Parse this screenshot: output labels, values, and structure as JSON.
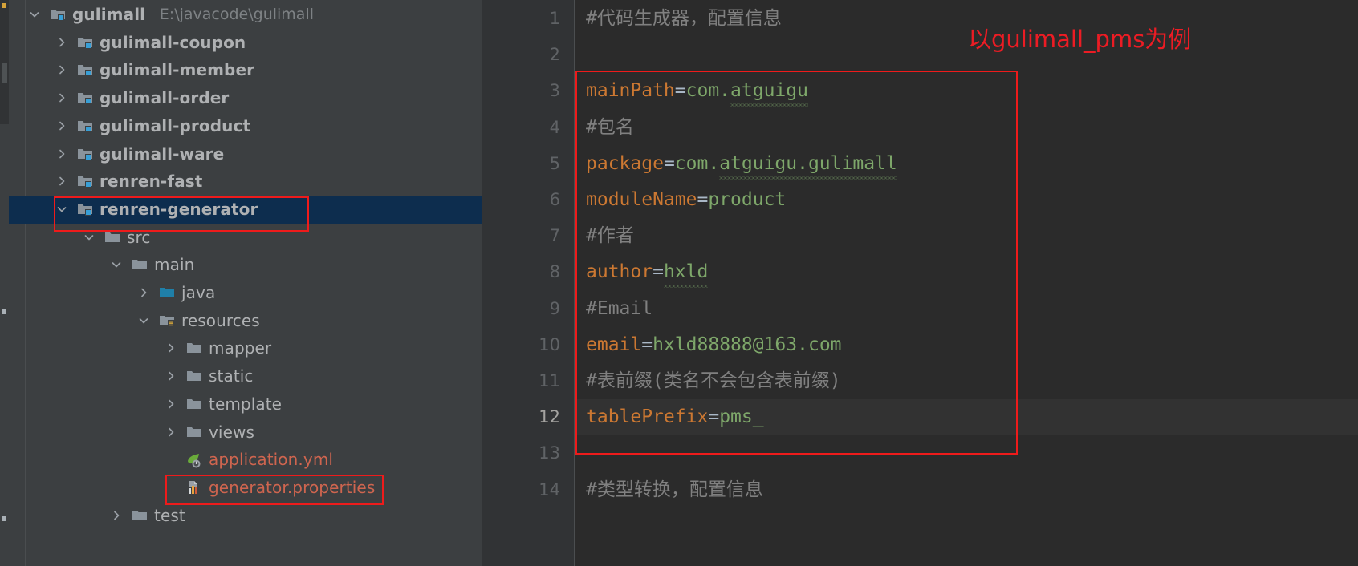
{
  "window": {
    "theme": "darcula",
    "accent_selection": "#0d2d4e",
    "annotation_color": "#ec1c24"
  },
  "sidebar": {
    "name": "project-tree",
    "rows": [
      {
        "label": "gulimall",
        "sublabel": "E:\\javacode\\gulimall",
        "icon": "module-folder-icon",
        "twisty": "expanded",
        "depth": 0,
        "bold": true,
        "selected": false,
        "type": "module"
      },
      {
        "label": "gulimall-coupon",
        "sublabel": "",
        "icon": "module-folder-icon",
        "twisty": "collapsed",
        "depth": 1,
        "bold": true,
        "selected": false,
        "type": "module"
      },
      {
        "label": "gulimall-member",
        "sublabel": "",
        "icon": "module-folder-icon",
        "twisty": "collapsed",
        "depth": 1,
        "bold": true,
        "selected": false,
        "type": "module"
      },
      {
        "label": "gulimall-order",
        "sublabel": "",
        "icon": "module-folder-icon",
        "twisty": "collapsed",
        "depth": 1,
        "bold": true,
        "selected": false,
        "type": "module"
      },
      {
        "label": "gulimall-product",
        "sublabel": "",
        "icon": "module-folder-icon",
        "twisty": "collapsed",
        "depth": 1,
        "bold": true,
        "selected": false,
        "type": "module"
      },
      {
        "label": "gulimall-ware",
        "sublabel": "",
        "icon": "module-folder-icon",
        "twisty": "collapsed",
        "depth": 1,
        "bold": true,
        "selected": false,
        "type": "module"
      },
      {
        "label": "renren-fast",
        "sublabel": "",
        "icon": "module-folder-icon",
        "twisty": "collapsed",
        "depth": 1,
        "bold": true,
        "selected": false,
        "type": "module"
      },
      {
        "label": "renren-generator",
        "sublabel": "",
        "icon": "module-folder-icon",
        "twisty": "expanded",
        "depth": 1,
        "bold": true,
        "selected": true,
        "type": "module"
      },
      {
        "label": "src",
        "sublabel": "",
        "icon": "folder-icon",
        "twisty": "expanded",
        "depth": 2,
        "bold": false,
        "selected": false,
        "type": "folder"
      },
      {
        "label": "main",
        "sublabel": "",
        "icon": "folder-icon",
        "twisty": "expanded",
        "depth": 3,
        "bold": false,
        "selected": false,
        "type": "folder"
      },
      {
        "label": "java",
        "sublabel": "",
        "icon": "source-folder-icon",
        "twisty": "collapsed",
        "depth": 4,
        "bold": false,
        "selected": false,
        "type": "source-root"
      },
      {
        "label": "resources",
        "sublabel": "",
        "icon": "resource-folder-icon",
        "twisty": "expanded",
        "depth": 4,
        "bold": false,
        "selected": false,
        "type": "resource-root"
      },
      {
        "label": "mapper",
        "sublabel": "",
        "icon": "folder-icon",
        "twisty": "collapsed",
        "depth": 5,
        "bold": false,
        "selected": false,
        "type": "folder"
      },
      {
        "label": "static",
        "sublabel": "",
        "icon": "folder-icon",
        "twisty": "collapsed",
        "depth": 5,
        "bold": false,
        "selected": false,
        "type": "folder"
      },
      {
        "label": "template",
        "sublabel": "",
        "icon": "folder-icon",
        "twisty": "collapsed",
        "depth": 5,
        "bold": false,
        "selected": false,
        "type": "folder"
      },
      {
        "label": "views",
        "sublabel": "",
        "icon": "folder-icon",
        "twisty": "collapsed",
        "depth": 5,
        "bold": false,
        "selected": false,
        "type": "folder"
      },
      {
        "label": "application.yml",
        "sublabel": "",
        "icon": "spring-yaml-icon",
        "twisty": "none",
        "depth": 5,
        "bold": false,
        "selected": false,
        "type": "file"
      },
      {
        "label": "generator.properties",
        "sublabel": "",
        "icon": "properties-file-icon",
        "twisty": "none",
        "depth": 5,
        "bold": false,
        "selected": false,
        "type": "file"
      },
      {
        "label": "test",
        "sublabel": "",
        "icon": "folder-icon",
        "twisty": "collapsed",
        "depth": 3,
        "bold": false,
        "selected": false,
        "type": "folder"
      }
    ]
  },
  "editor": {
    "name": "generator-properties-editor",
    "current_line": 12,
    "line_numbers": [
      1,
      2,
      3,
      4,
      5,
      6,
      7,
      8,
      9,
      10,
      11,
      12,
      13,
      14
    ],
    "lines": [
      {
        "n": 1,
        "kind": "comment",
        "text": "#代码生成器，配置信息"
      },
      {
        "n": 2,
        "kind": "blank",
        "text": ""
      },
      {
        "n": 3,
        "kind": "pair",
        "key": "mainPath",
        "eq": "=",
        "value": "com.atguigu",
        "squiggle_from": 4
      },
      {
        "n": 4,
        "kind": "comment",
        "text": "#包名"
      },
      {
        "n": 5,
        "kind": "pair",
        "key": "package",
        "eq": "=",
        "value": "com.atguigu.gulimall",
        "squiggle_from": 4
      },
      {
        "n": 6,
        "kind": "pair",
        "key": "moduleName",
        "eq": "=",
        "value": "product",
        "squiggle_from": -1
      },
      {
        "n": 7,
        "kind": "comment",
        "text": "#作者"
      },
      {
        "n": 8,
        "kind": "pair",
        "key": "author",
        "eq": "=",
        "value": "hxld",
        "squiggle_from": 0
      },
      {
        "n": 9,
        "kind": "comment",
        "text": "#Email"
      },
      {
        "n": 10,
        "kind": "pair",
        "key": "email",
        "eq": "=",
        "value": "hxld88888@163.com",
        "squiggle_from": -1
      },
      {
        "n": 11,
        "kind": "comment",
        "text": "#表前缀(类名不会包含表前缀)"
      },
      {
        "n": 12,
        "kind": "pair",
        "key": "tablePrefix",
        "eq": "=",
        "value": "pms_",
        "squiggle_from": -1
      },
      {
        "n": 13,
        "kind": "blank",
        "text": ""
      },
      {
        "n": 14,
        "kind": "comment",
        "text": "#类型转换，配置信息"
      }
    ]
  },
  "annotations": {
    "note_text": "以gulimall_pms为例",
    "boxes": [
      {
        "name": "highlight-box-renren-generator"
      },
      {
        "name": "highlight-box-generator-properties"
      },
      {
        "name": "highlight-box-config-block"
      }
    ]
  }
}
